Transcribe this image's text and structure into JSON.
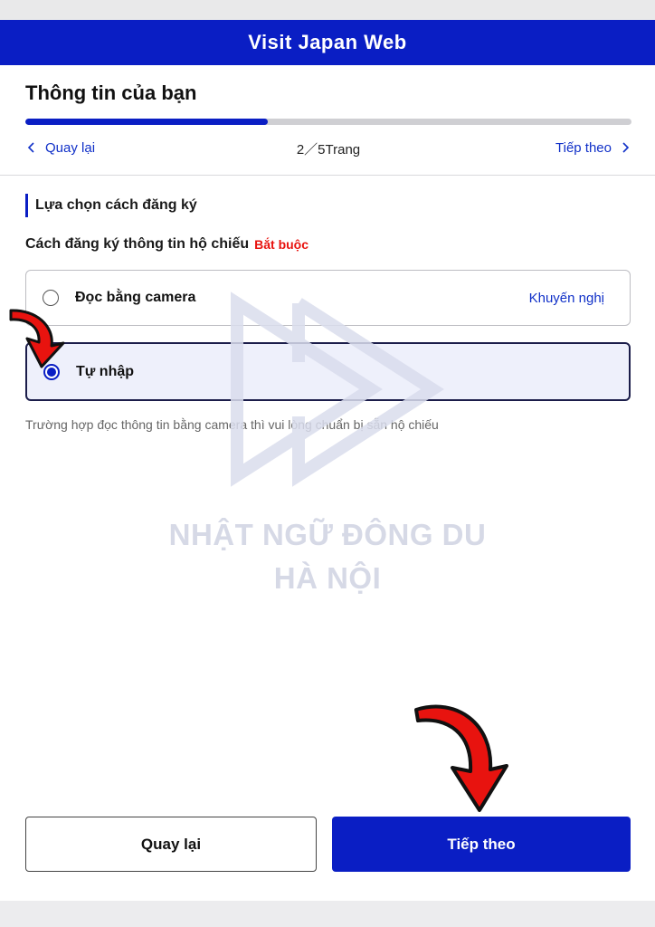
{
  "header": {
    "title": "Visit Japan Web"
  },
  "page": {
    "title": "Thông tin của bạn"
  },
  "progress": {
    "fraction": 0.4
  },
  "nav": {
    "back_label": "Quay lại",
    "page_indicator": "2／5Trang",
    "next_label": "Tiếp theo"
  },
  "section": {
    "heading": "Lựa chọn cách đăng ký"
  },
  "field": {
    "label": "Cách đăng ký thông tin hộ chiếu",
    "required": "Bắt buộc"
  },
  "options": [
    {
      "label": "Đọc bằng camera",
      "badge": "Khuyến nghị",
      "selected": false
    },
    {
      "label": "Tự nhập",
      "selected": true
    }
  ],
  "note": "Trường hợp đọc thông tin bằng camera thì vui lòng chuẩn bị sẵn hộ chiếu",
  "watermark": {
    "line1": "NHẬT NGỮ ĐÔNG DU",
    "line2": "HÀ NỘI"
  },
  "footer": {
    "back_button": "Quay lại",
    "next_button": "Tiếp theo"
  },
  "colors": {
    "brand": "#0a1ec4",
    "required": "#e8130f",
    "arrow": "#e8130f"
  }
}
